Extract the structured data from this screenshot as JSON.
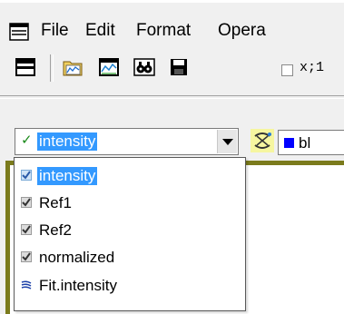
{
  "menubar": {
    "items": [
      "File",
      "Edit",
      "Format",
      "Opera"
    ]
  },
  "toolbar": {
    "xy_label": "x;1"
  },
  "layer_combo": {
    "selected": "intensity"
  },
  "color_selector": {
    "value": "bl",
    "swatch_color": "#0000ff"
  },
  "layer_list": {
    "items": [
      {
        "label": "intensity",
        "icon": "line-check-icon",
        "selected": true
      },
      {
        "label": "Ref1",
        "icon": "check-icon",
        "selected": false
      },
      {
        "label": "Ref2",
        "icon": "check-icon",
        "selected": false
      },
      {
        "label": "normalized",
        "icon": "check-icon",
        "selected": false
      },
      {
        "label": "Fit.intensity",
        "icon": "fit-curve-icon",
        "selected": false
      }
    ]
  },
  "colors": {
    "accent": "#3399ff",
    "frame": "#7b7b1c"
  }
}
